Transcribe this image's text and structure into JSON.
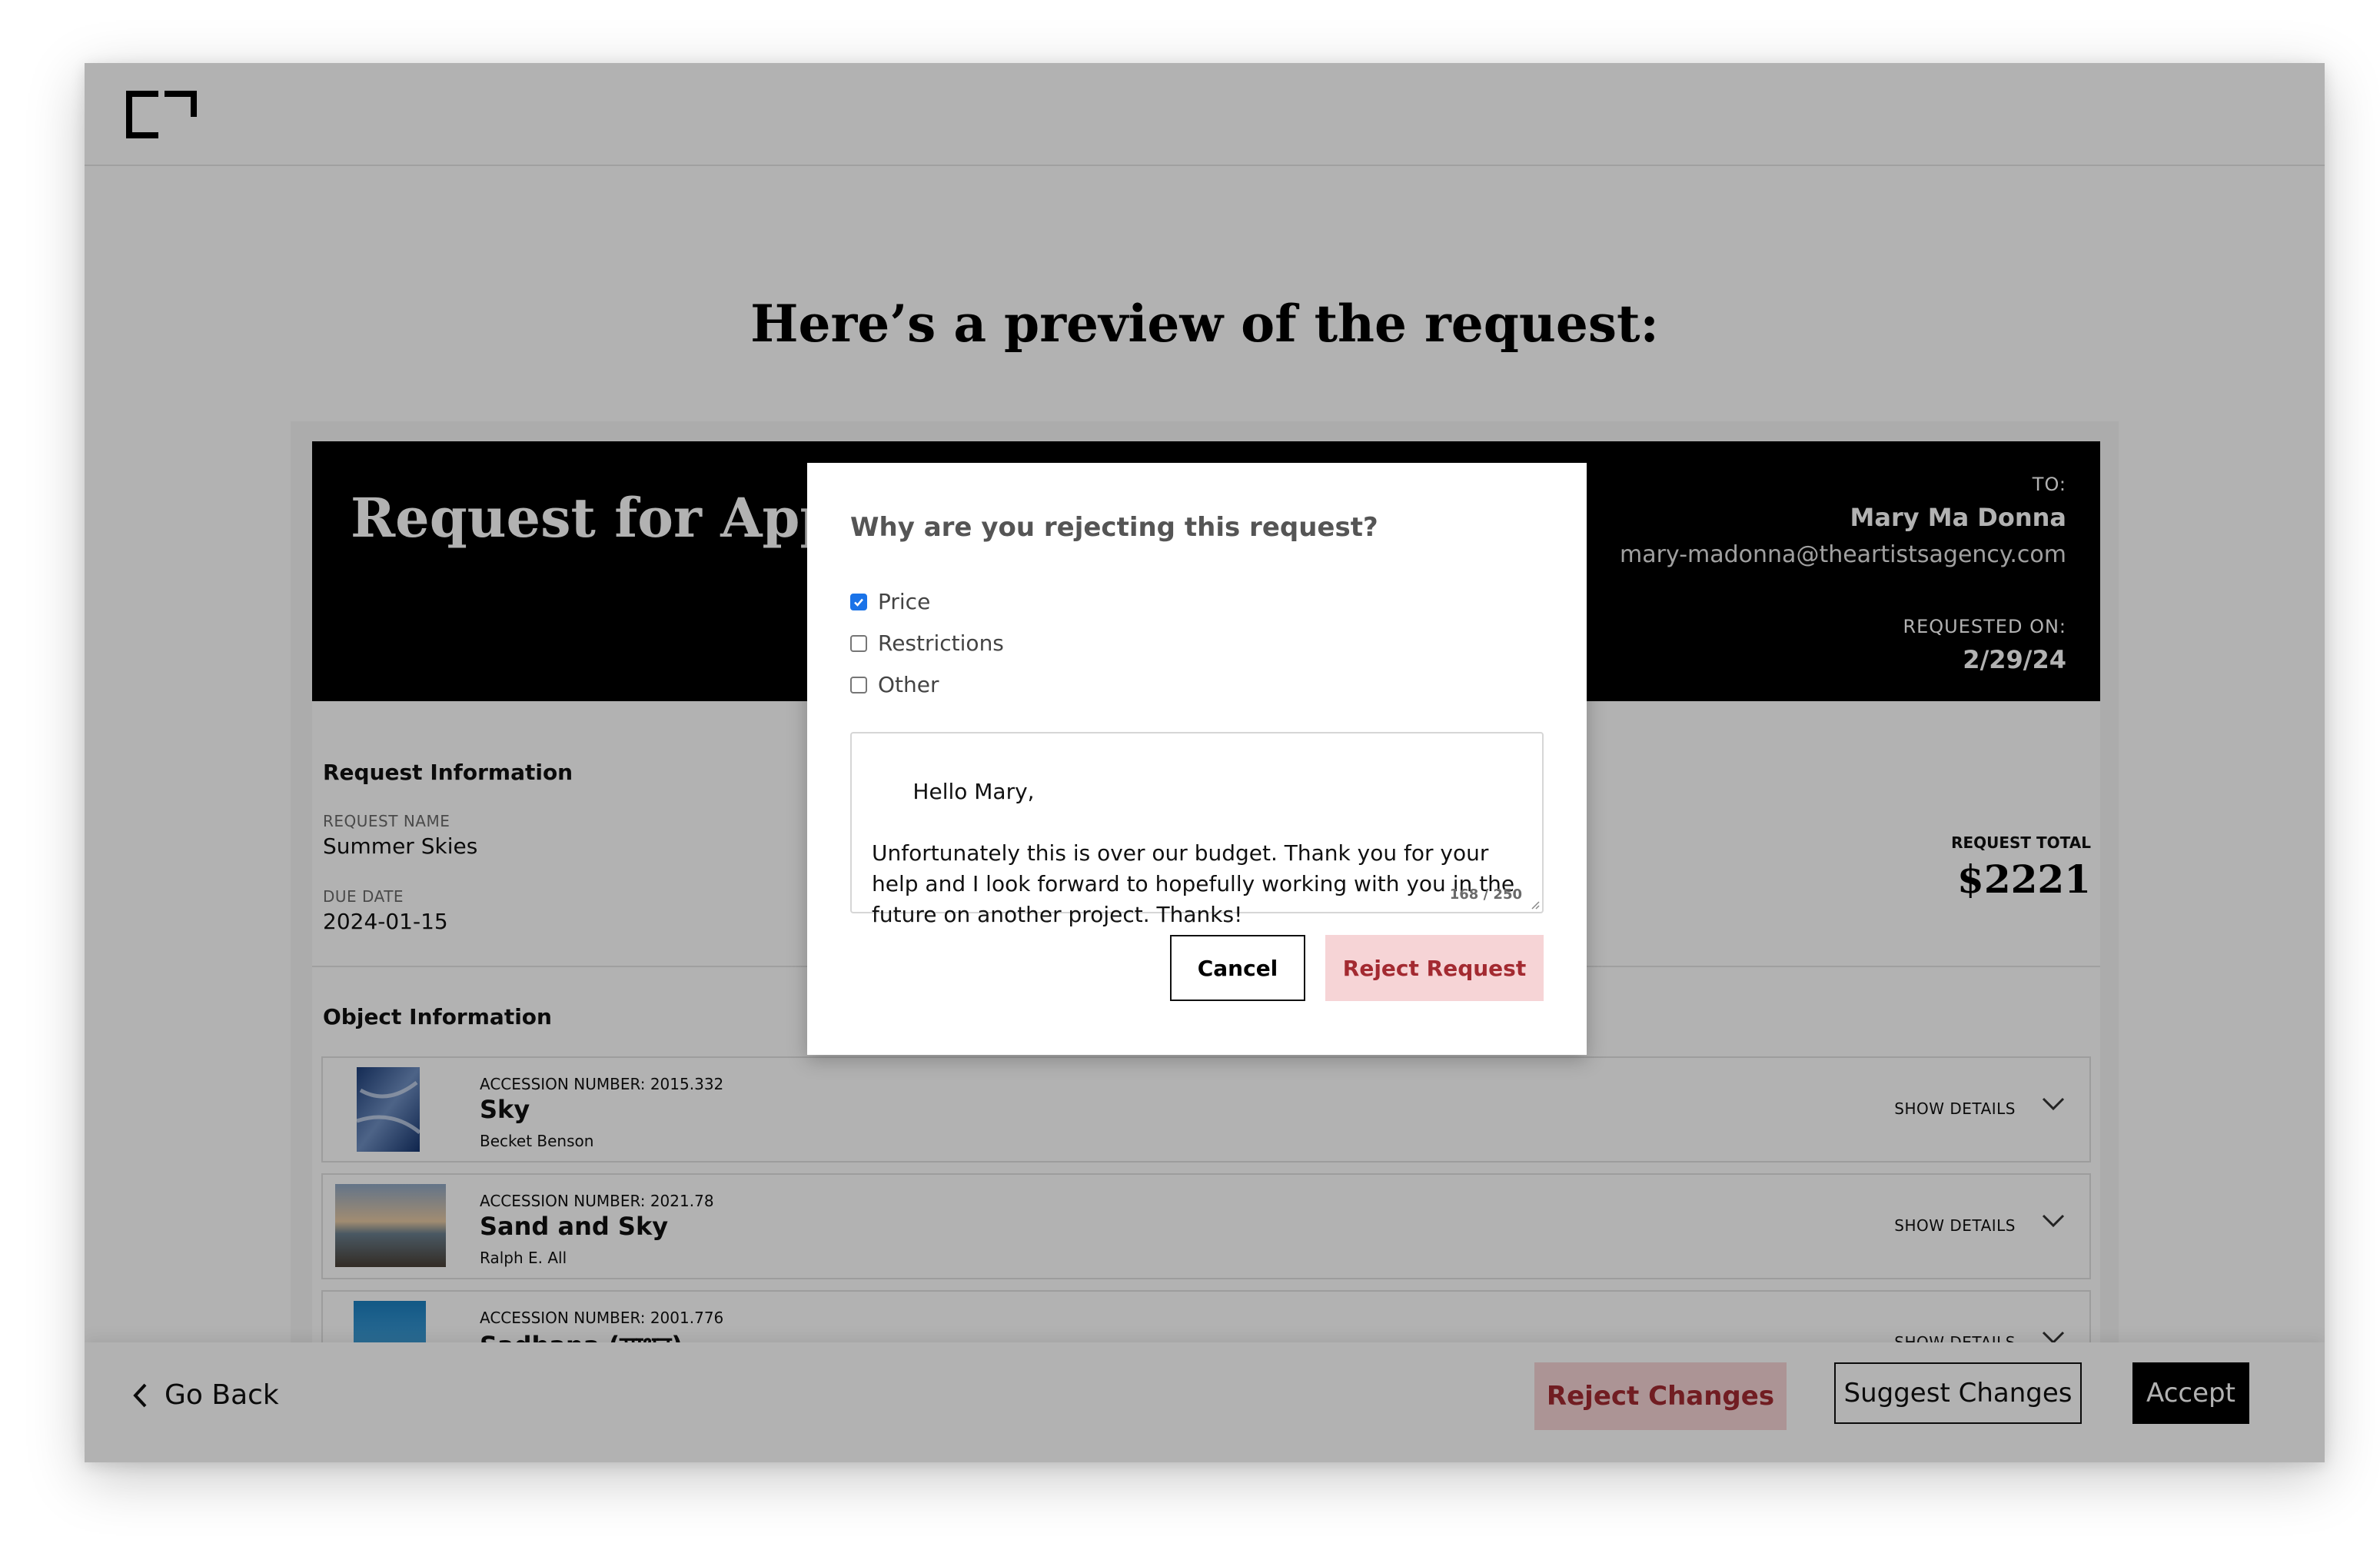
{
  "page": {
    "title": "Here’s a preview of the request:"
  },
  "banner": {
    "title": "Request for Approval",
    "to_label": "TO:",
    "to_name": "Mary Ma Donna",
    "to_email": "mary-madonna@theartistsagency.com",
    "requested_on_label": "REQUESTED ON:",
    "requested_on_date": "2/29/24"
  },
  "request_info": {
    "section_title": "Request Information",
    "name_label": "REQUEST NAME",
    "name_value": "Summer Skies",
    "due_label": "DUE DATE",
    "due_value": "2024-01-15",
    "total_label": "REQUEST TOTAL",
    "total_value": "$2221"
  },
  "object_info": {
    "section_title": "Object Information",
    "objects": [
      {
        "accession": "ACCESSION NUMBER: 2015.332",
        "name": "Sky",
        "artist": "Becket Benson",
        "show_details": "SHOW DETAILS"
      },
      {
        "accession": "ACCESSION NUMBER: 2021.78",
        "name": "Sand and Sky",
        "artist": "Ralph E. All",
        "show_details": "SHOW DETAILS"
      },
      {
        "accession": "ACCESSION NUMBER: 2001.776",
        "name": "Sadhana (साधन)",
        "artist": "",
        "show_details": "SHOW DETAILS"
      }
    ]
  },
  "bottom_bar": {
    "go_back": "Go Back",
    "reject_changes": "Reject Changes",
    "suggest_changes": "Suggest Changes",
    "accept": "Accept"
  },
  "modal": {
    "title": "Why are you rejecting this request?",
    "options": [
      {
        "label": "Price",
        "checked": true
      },
      {
        "label": "Restrictions",
        "checked": false
      },
      {
        "label": "Other",
        "checked": false
      }
    ],
    "message": "Hello Mary,\n\nUnfortunately this is over our budget. Thank you for your help and I look forward to hopefully working with you in the future on another project. Thanks!",
    "char_count": "168 / 250",
    "cancel": "Cancel",
    "reject": "Reject Request"
  },
  "colors": {
    "accent_red_text": "#a32a31",
    "accent_red_bg": "#f6d4d6",
    "checkbox_blue": "#1a73e8"
  }
}
